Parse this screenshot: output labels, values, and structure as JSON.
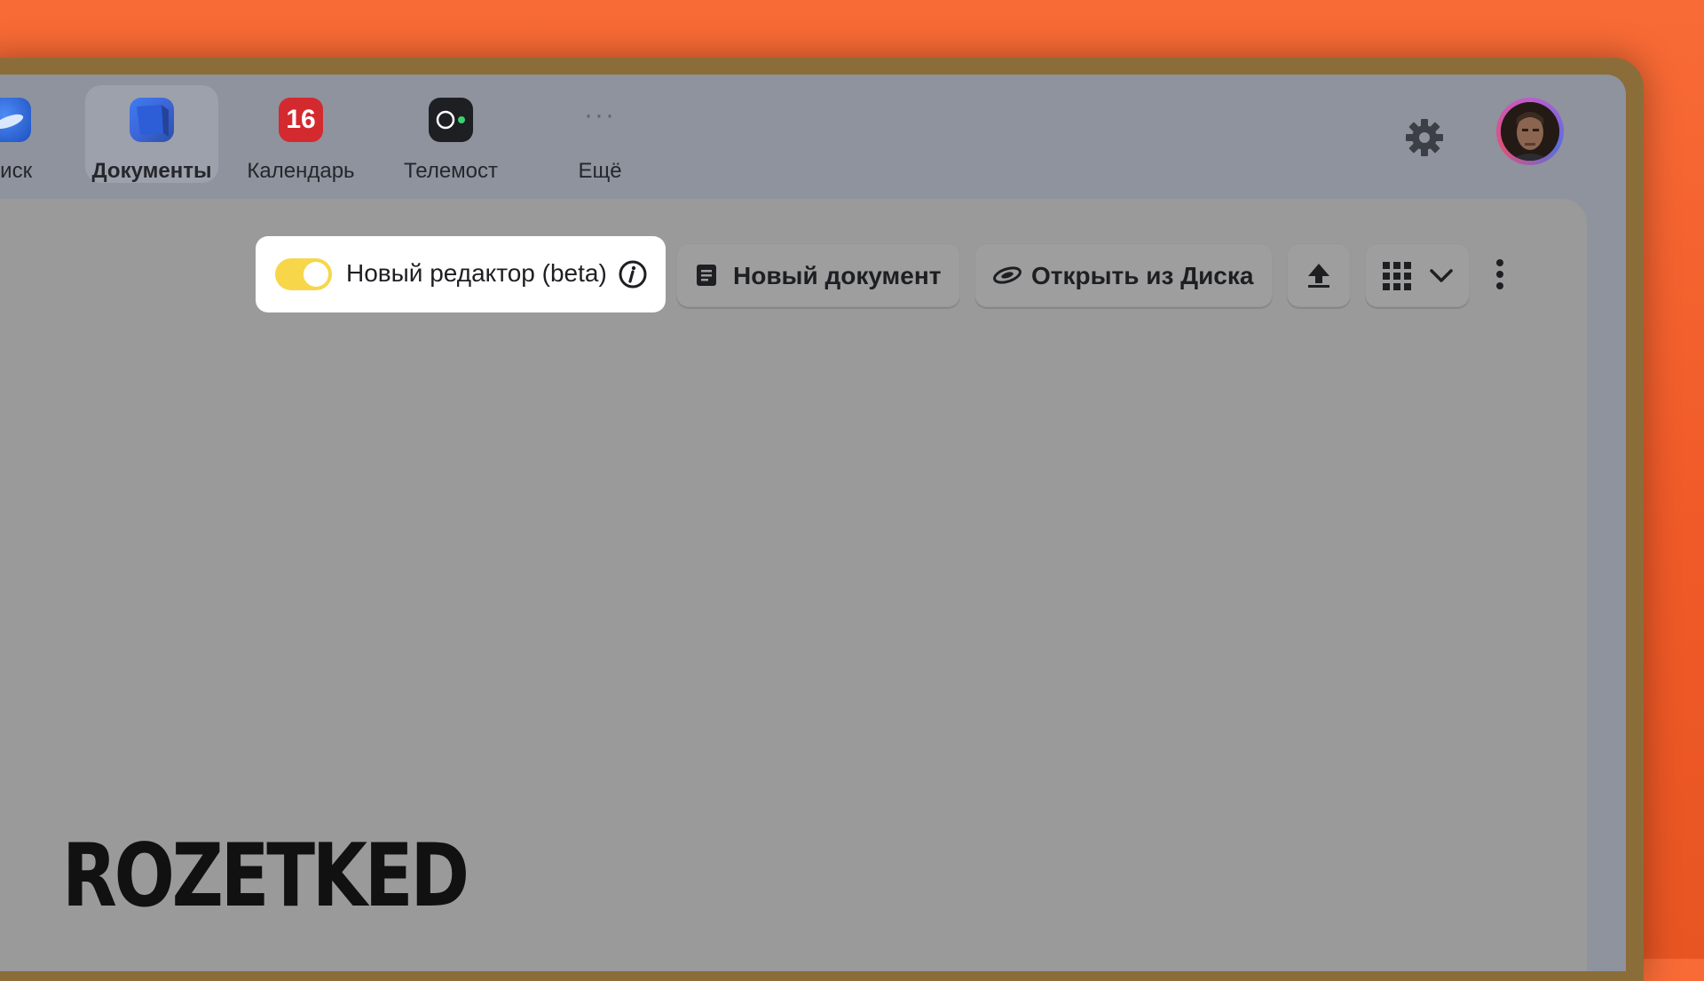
{
  "services": [
    {
      "label": "Диск",
      "icon": "disk-icon"
    },
    {
      "label": "Документы",
      "icon": "documents-icon",
      "active": true
    },
    {
      "label": "Календарь",
      "icon": "calendar-icon",
      "badge": "16"
    },
    {
      "label": "Телемост",
      "icon": "telemost-icon"
    },
    {
      "label": "Ещё",
      "icon": "more-dots-icon"
    }
  ],
  "toolbar": {
    "editor_toggle_label": "Новый редактор (beta)",
    "editor_toggle_on": true,
    "new_document_label": "Новый документ",
    "open_from_disk_label": "Открыть из Диска",
    "upload_icon": "upload-icon",
    "view_icon": "grid-view-icon",
    "more_icon": "more-vertical-icon"
  },
  "colors": {
    "background": "#f05a28",
    "toggle_on": "#f7d64a",
    "calendar_badge": "#d32a2f"
  },
  "watermark": "ROZETKED"
}
